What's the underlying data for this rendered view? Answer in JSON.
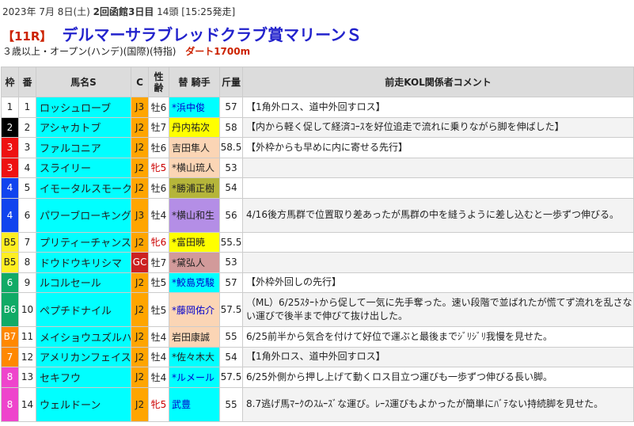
{
  "header": {
    "date": "2023年 7月 8日(土)",
    "venue": "2回函館3日目",
    "heads": "14頭",
    "start": "[15:25発走]",
    "race_no": "【11R】",
    "race_name": "デルマーサラブレッドクラブ賞マリーンＳ",
    "conditions": "３歳以上・オープン(ハンデ)(国際)(特指)",
    "distance": "ダート1700m"
  },
  "columns": {
    "waku": "枠",
    "num": "番",
    "name": "馬名S",
    "cls": "C",
    "sex_age_top": "性",
    "sex_age_bottom": "齢",
    "jockey": "替 騎手",
    "weight": "斤量",
    "comment": "前走KOL関係者コメント"
  },
  "rows": [
    {
      "waku": "1",
      "waku_bg": "#ffffff",
      "waku_fg": "#222222",
      "num": "1",
      "name": "ロッシュローブ",
      "cls": "J3",
      "sex": "牡6",
      "sex_color": "#222222",
      "jockey": "*浜中俊",
      "jockey_bg": "#00ffff",
      "jockey_fg": "#0000cc",
      "kin": "57",
      "comment": "【1角外ロス、道中外回すロス】"
    },
    {
      "waku": "2",
      "waku_bg": "#000000",
      "waku_fg": "#ffffff",
      "num": "2",
      "name": "アシャカトブ",
      "cls": "J2",
      "sex": "牡7",
      "sex_color": "#222222",
      "jockey": "丹内祐次",
      "jockey_bg": "#ffff00",
      "jockey_fg": "#222222",
      "kin": "58",
      "comment": "【内から軽く促して経済ｺｰｽを好位追走で流れに乗りながら脚を伸ばした】"
    },
    {
      "waku": "3",
      "waku_bg": "#ee1111",
      "waku_fg": "#ffffff",
      "num": "3",
      "name": "ファルコニア",
      "cls": "J2",
      "sex": "牡6",
      "sex_color": "#222222",
      "jockey": "吉田隼人",
      "jockey_bg": "#fbd5b5",
      "jockey_fg": "#222222",
      "kin": "58.5",
      "comment": "【外枠からも早めに内に寄せる先行】"
    },
    {
      "waku": "3",
      "waku_bg": "#ee1111",
      "waku_fg": "#ffffff",
      "num": "4",
      "name": "スライリー",
      "cls": "J2",
      "sex": "牝5",
      "sex_color": "#cc0000",
      "jockey": "*横山琉人",
      "jockey_bg": "#fbd5b5",
      "jockey_fg": "#222222",
      "kin": "53",
      "comment": ""
    },
    {
      "waku": "4",
      "waku_bg": "#1144ee",
      "waku_fg": "#ffffff",
      "num": "5",
      "name": "イモータルスモーク",
      "cls": "J2",
      "sex": "牡6",
      "sex_color": "#222222",
      "jockey": "*勝浦正樹",
      "jockey_bg": "#b5b53a",
      "jockey_fg": "#222222",
      "kin": "54",
      "comment": ""
    },
    {
      "waku": "4",
      "waku_bg": "#1144ee",
      "waku_fg": "#ffffff",
      "num": "6",
      "name": "パワーブローキング",
      "cls": "J3",
      "sex": "牡4",
      "sex_color": "#222222",
      "jockey": "*横山和生",
      "jockey_bg": "#b48ee6",
      "jockey_fg": "#222222",
      "kin": "56",
      "comment": "4/16後方馬群で位置取り差あったが馬群の中を縫うように差し込むと一歩ずつ伸びる。",
      "tall": true
    },
    {
      "waku": "B5",
      "waku_bg": "#ffee22",
      "waku_fg": "#222222",
      "num": "7",
      "name": "プリティーチャンス",
      "cls": "J2",
      "sex": "牝6",
      "sex_color": "#cc0000",
      "jockey": "*富田暁",
      "jockey_bg": "#ffff00",
      "jockey_fg": "#222222",
      "kin": "55.5",
      "comment": ""
    },
    {
      "waku": "B5",
      "waku_bg": "#ffee22",
      "waku_fg": "#222222",
      "num": "8",
      "name": "ドウドウキリシマ",
      "cls": "GC",
      "sex": "牡7",
      "sex_color": "#222222",
      "jockey": "*黛弘人",
      "jockey_bg": "#d29a9a",
      "jockey_fg": "#222222",
      "kin": "53",
      "comment": ""
    },
    {
      "waku": "6",
      "waku_bg": "#11aa66",
      "waku_fg": "#ffffff",
      "num": "9",
      "name": "ルコルセール",
      "cls": "J2",
      "sex": "牡5",
      "sex_color": "#222222",
      "jockey": "*鮫島克駿",
      "jockey_bg": "#00ffff",
      "jockey_fg": "#0000cc",
      "kin": "57",
      "comment": "【外枠外回しの先行】"
    },
    {
      "waku": "B6",
      "waku_bg": "#11aa66",
      "waku_fg": "#ffffff",
      "num": "10",
      "name": "ペプチドナイル",
      "cls": "J2",
      "sex": "牡5",
      "sex_color": "#222222",
      "jockey": "*藤岡佑介",
      "jockey_bg": "#fbd5b5",
      "jockey_fg": "#0000cc",
      "kin": "57.5",
      "comment": "（ML）6/25ｽﾀｰﾄから促して一気に先手奪った。速い段階で並ばれたが慌てず流れを乱さない運びで後半まで伸びて抜け出した。",
      "tall": true
    },
    {
      "waku": "B7",
      "waku_bg": "#ff8800",
      "waku_fg": "#ffffff",
      "num": "11",
      "name": "メイショウユズルハ",
      "cls": "J2",
      "sex": "牡4",
      "sex_color": "#222222",
      "jockey": "岩田康誠",
      "jockey_bg": "#fbd5b5",
      "jockey_fg": "#222222",
      "kin": "55",
      "comment": "6/25前半から気合を付けて好位で運ぶと最後までｼﾞﾘｼﾞﾘ我慢を見せた。"
    },
    {
      "waku": "7",
      "waku_bg": "#ff8800",
      "waku_fg": "#ffffff",
      "num": "12",
      "name": "アメリカンフェイス",
      "cls": "J2",
      "sex": "牡4",
      "sex_color": "#222222",
      "jockey": "*佐々木大",
      "jockey_bg": "#00ffff",
      "jockey_fg": "#222222",
      "kin": "54",
      "comment": "【1角外ロス、道中外回すロス】"
    },
    {
      "waku": "8",
      "waku_bg": "#ee44cc",
      "waku_fg": "#ffffff",
      "num": "13",
      "name": "セキフウ",
      "cls": "J2",
      "sex": "牡4",
      "sex_color": "#222222",
      "jockey": "*ルメール",
      "jockey_bg": "#00ffff",
      "jockey_fg": "#0000cc",
      "kin": "57.5",
      "comment": "6/25外側から押し上げて動くロス目立つ運びも一歩ずつ伸びる長い脚。"
    },
    {
      "waku": "8",
      "waku_bg": "#ee44cc",
      "waku_fg": "#ffffff",
      "num": "14",
      "name": "ウェルドーン",
      "cls": "J2",
      "sex": "牝5",
      "sex_color": "#cc0000",
      "jockey": "武豊",
      "jockey_bg": "#00ffff",
      "jockey_fg": "#0000cc",
      "kin": "55",
      "comment": "8.7逃げ馬ﾏｰｸのｽﾑｰｽﾞな運び。ﾚｰｽ運びもよかったが簡単にﾊﾞﾃない持続脚を見せた。",
      "tall": true
    }
  ]
}
